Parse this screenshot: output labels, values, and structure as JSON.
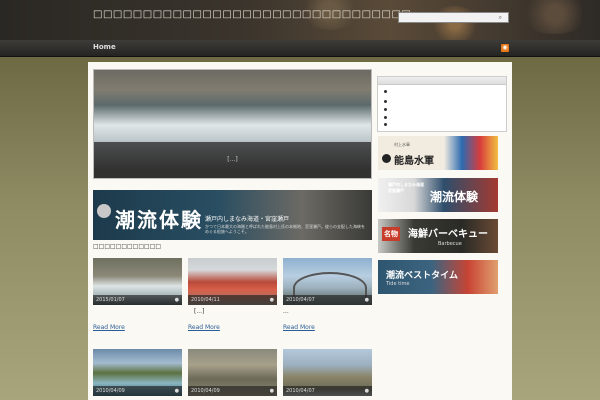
{
  "header": {
    "site_title": "□□□□□□□□□□□□□□□□□□□□□□□□□□□□□□□□",
    "search_placeholder": ""
  },
  "nav": {
    "home": "Home"
  },
  "icons": {
    "search": "search-icon",
    "rss": "rss-icon",
    "comment": "comment-icon"
  },
  "slider": {
    "caption": "[...]"
  },
  "banner": {
    "title": "潮流体験",
    "subtitle": "瀬戸内しまなみ海道・宮窪瀬戸",
    "description": "かつて日本最大の海賊と呼ばれた能島村上氏の本拠地、宮窪瀬戸。彼らの支配した海峡をめぐる船旅へようこそ。"
  },
  "section_title": "□□□□□□□□□□□□",
  "posts": [
    {
      "date": "2015/01/07",
      "excerpt": "",
      "read_more": "Read More"
    },
    {
      "date": "2010/04/11",
      "excerpt": "[...]",
      "read_more": "Read More"
    },
    {
      "date": "2010/04/07",
      "excerpt": "...",
      "read_more": "Read More"
    },
    {
      "date": "2010/04/09",
      "excerpt": "",
      "read_more": ""
    },
    {
      "date": "2010/04/09",
      "excerpt": "",
      "read_more": ""
    },
    {
      "date": "2010/04/07",
      "excerpt": "",
      "read_more": ""
    }
  ],
  "sidebar": {
    "banners": [
      {
        "line1": "村上水軍",
        "line2": "能島水軍"
      },
      {
        "line1": "瀬戸内しまなみ海道",
        "line2": "宮窪瀬戸",
        "line3": "潮流体験"
      },
      {
        "line1": "名物",
        "line2": "海鮮バーベキュー",
        "line3": "Barbecue"
      },
      {
        "line1": "潮流ベストタイム",
        "line2": "Tide time"
      }
    ]
  }
}
